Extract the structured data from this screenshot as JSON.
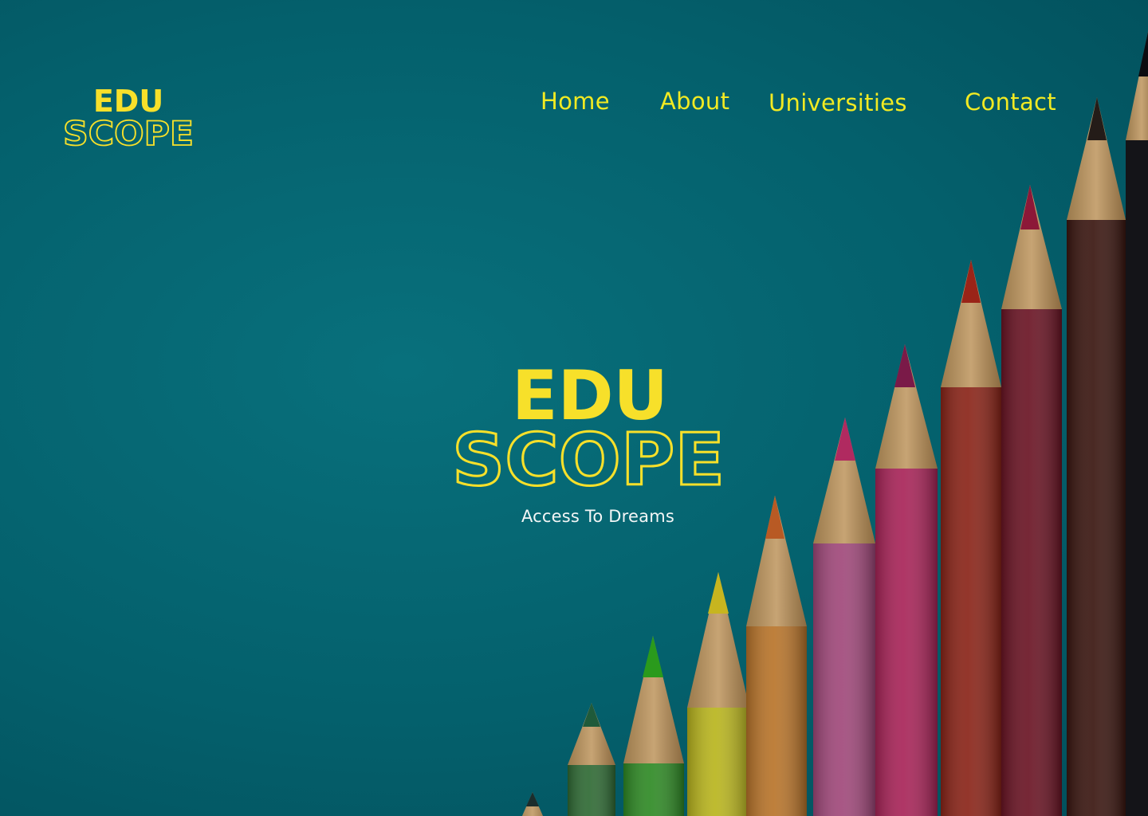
{
  "brand": {
    "line1": "EDU",
    "line2": "SCOPE",
    "color": "#f7e02a"
  },
  "nav": {
    "home": "Home",
    "about": "About",
    "universities": "Universities",
    "contact": "Contact"
  },
  "hero": {
    "title_line1": "EDU",
    "title_line2": "SCOPE",
    "tagline": "Access To Dreams"
  },
  "background": {
    "color": "#03606e",
    "image": "colored-pencils"
  }
}
